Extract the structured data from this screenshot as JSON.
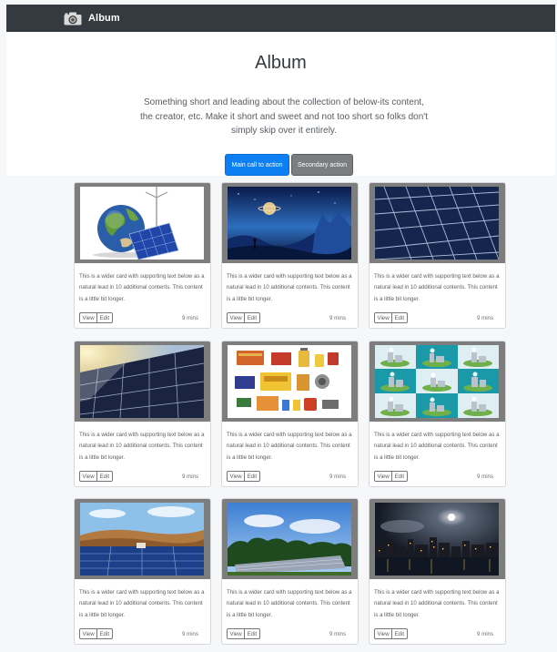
{
  "navbar": {
    "brand": "Album",
    "icon": "camera-icon",
    "background": "#343a40"
  },
  "hero": {
    "title": "Album",
    "lead": "Something short and leading about the collection of below-its content, the creator, etc. Make it short and sweet and not too short so folks don't simply skip over it entirely.",
    "primary_button": "Main call to action",
    "secondary_button": "Secondary action",
    "primary_color": "#0d7ff2",
    "secondary_color": "#7b7d80"
  },
  "cards": [
    {
      "image": "globe-solar-panel-image",
      "text": "This is a wider card with supporting text below as a natural lead in 10 additional contents. This content is a little bit longer.",
      "view": "View",
      "edit": "Edit",
      "time": "9 mins"
    },
    {
      "image": "space-planet-landscape-image",
      "text": "This is a wider card with supporting text below as a natural lead in 10 additional contents. This content is a little bit longer.",
      "view": "View",
      "edit": "Edit",
      "time": "9 mins"
    },
    {
      "image": "solar-panel-closeup-image",
      "text": "This is a wider card with supporting text below as a natural lead in 10 additional contents. This content is a little bit longer.",
      "view": "View",
      "edit": "Edit",
      "time": "9 mins"
    },
    {
      "image": "solar-panels-sunlight-image",
      "text": "This is a wider card with supporting text below as a natural lead in 10 additional contents. This content is a little bit longer.",
      "view": "View",
      "edit": "Edit",
      "time": "9 mins"
    },
    {
      "image": "battery-components-image",
      "text": "This is a wider card with supporting text below as a natural lead in 10 additional contents. This content is a little bit longer.",
      "view": "View",
      "edit": "Edit",
      "time": "9 mins"
    },
    {
      "image": "power-plant-icons-grid-image",
      "text": "This is a wider card with supporting text below as a natural lead in 10 additional contents. This content is a little bit longer.",
      "view": "View",
      "edit": "Edit",
      "time": "9 mins"
    },
    {
      "image": "solar-farm-hills-image",
      "text": "This is a wider card with supporting text below as a natural lead in 10 additional contents. This content is a little bit longer.",
      "view": "View",
      "edit": "Edit",
      "time": "9 mins"
    },
    {
      "image": "solar-field-trees-image",
      "text": "This is a wider card with supporting text below as a natural lead in 10 additional contents. This content is a little bit longer.",
      "view": "View",
      "edit": "Edit",
      "time": "9 mins"
    },
    {
      "image": "city-night-skyline-image",
      "text": "This is a wider card with supporting text below as a natural lead in 10 additional contents. This content is a little bit longer.",
      "view": "View",
      "edit": "Edit",
      "time": "9 mins"
    }
  ]
}
